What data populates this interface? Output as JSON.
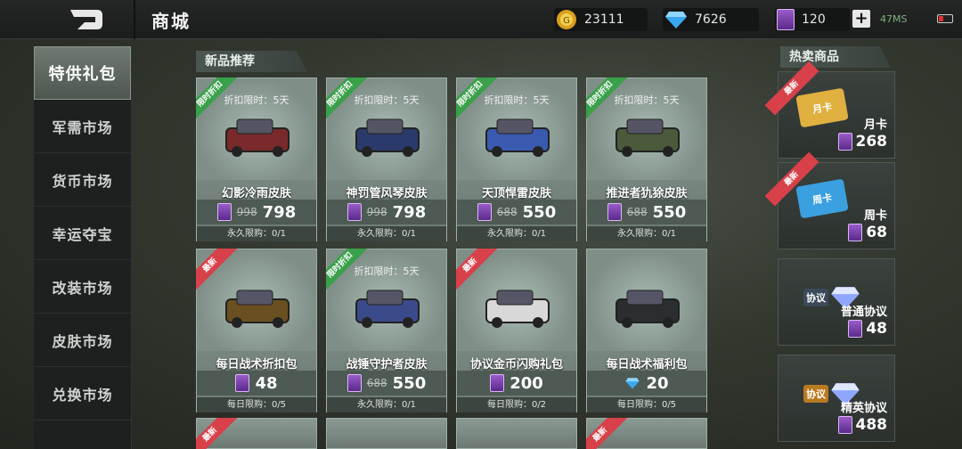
{
  "header": {
    "title": "商城"
  },
  "currencies": {
    "gold": "23111",
    "diamond": "7626",
    "coupon": "120"
  },
  "status": {
    "ping": "47MS"
  },
  "sidebar": {
    "items": [
      "特供礼包",
      "军需市场",
      "货币市场",
      "幸运夺宝",
      "改装市场",
      "皮肤市场",
      "兑换市场"
    ]
  },
  "sections": {
    "new": "新品推荐",
    "hot": "热卖商品"
  },
  "cards": [
    {
      "ribbon": "限时折扣",
      "ribbon_color": "green",
      "timer": "折扣限时：5天",
      "name": "幻影冷雨皮肤",
      "currency": "coupon",
      "old": "998",
      "price": "798",
      "limit": "永久限购：0/1"
    },
    {
      "ribbon": "限时折扣",
      "ribbon_color": "green",
      "timer": "折扣限时：5天",
      "name": "神罚管风琴皮肤",
      "currency": "coupon",
      "old": "998",
      "price": "798",
      "limit": "永久限购：0/1"
    },
    {
      "ribbon": "限时折扣",
      "ribbon_color": "green",
      "timer": "折扣限时：5天",
      "name": "天顶悍雷皮肤",
      "currency": "coupon",
      "old": "688",
      "price": "550",
      "limit": "永久限购：0/1"
    },
    {
      "ribbon": "限时折扣",
      "ribbon_color": "green",
      "timer": "折扣限时：5天",
      "name": "推进者犰狳皮肤",
      "currency": "coupon",
      "old": "688",
      "price": "550",
      "limit": "永久限购：0/1"
    },
    {
      "ribbon": "最新",
      "ribbon_color": "red",
      "timer": "",
      "name": "每日战术折扣包",
      "currency": "coupon",
      "old": "",
      "price": "48",
      "limit": "每日限购：0/5"
    },
    {
      "ribbon": "限时折扣",
      "ribbon_color": "green",
      "timer": "折扣限时：5天",
      "name": "战锤守护者皮肤",
      "currency": "coupon",
      "old": "688",
      "price": "550",
      "limit": "永久限购：0/1"
    },
    {
      "ribbon": "最新",
      "ribbon_color": "red",
      "timer": "",
      "name": "协议金币闪购礼包",
      "currency": "coupon",
      "old": "",
      "price": "200",
      "limit": "每日限购：0/2"
    },
    {
      "ribbon": "",
      "ribbon_color": "",
      "timer": "",
      "name": "每日战术福利包",
      "currency": "diamond",
      "old": "",
      "price": "20",
      "limit": "每日限购：0/5"
    }
  ],
  "partial_ribbons": [
    "最新",
    "最新"
  ],
  "hot": [
    {
      "ribbon": "最新",
      "name": "月卡",
      "price": "268",
      "art": "月卡"
    },
    {
      "ribbon": "最新",
      "name": "周卡",
      "price": "68",
      "art": "周卡"
    },
    {
      "ribbon": "",
      "name": "普通协议",
      "price": "48",
      "art": "协议"
    },
    {
      "ribbon": "",
      "name": "精英协议",
      "price": "488",
      "art": "协议"
    }
  ],
  "colors": {
    "accent_green": "#3aa04a",
    "accent_red": "#d8404a",
    "coupon_purple": "#7a3fb0"
  }
}
